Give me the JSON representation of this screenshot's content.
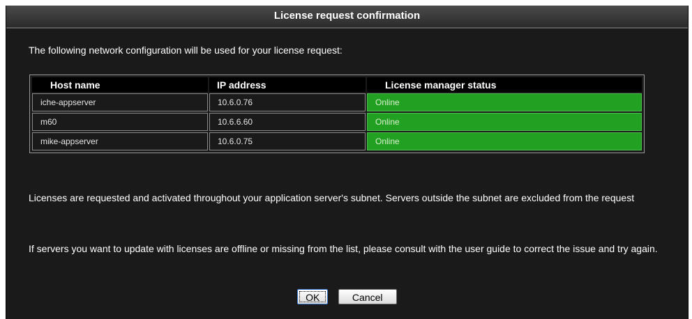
{
  "dialog": {
    "title": "License request confirmation",
    "intro": "The following network configuration will be used for your license request:",
    "table": {
      "headers": [
        "Host name",
        "IP address",
        "License manager status"
      ],
      "rows": [
        [
          "iche-appserver",
          "10.6.0.76",
          "Online"
        ],
        [
          "m60",
          "10.6.6.60",
          "Online"
        ],
        [
          "mike-appserver",
          "10.6.0.75",
          "Online"
        ]
      ]
    },
    "note1": "Licenses are requested and activated throughout your application server's subnet. Servers outside the subnet are excluded from the request",
    "note2": "If servers you want to update with licenses are offline or missing from the list, please consult with the user guide to correct the issue and try again.",
    "ok_label": "OK",
    "cancel_label": "Cancel"
  },
  "colors": {
    "background": "#1a1a1a",
    "online": "#22a022",
    "header": "#000000"
  }
}
